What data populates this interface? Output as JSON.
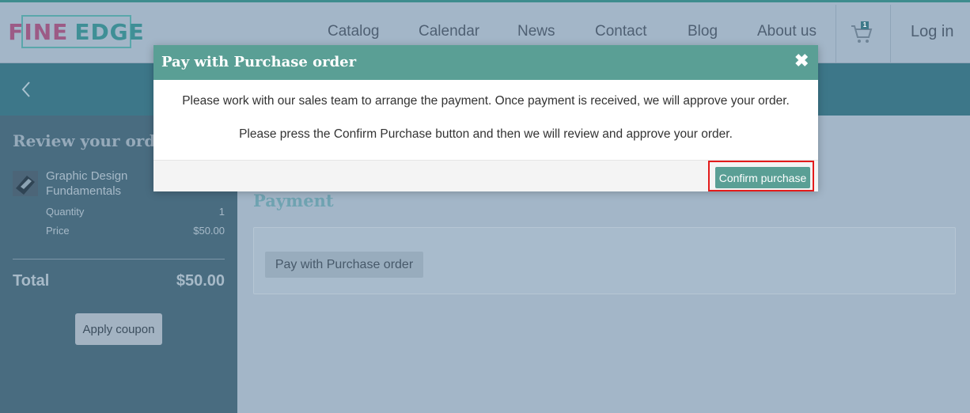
{
  "header": {
    "logo_word1": "FINE",
    "logo_word2": "EDGE",
    "nav": [
      "Catalog",
      "Calendar",
      "News",
      "Contact",
      "Blog",
      "About us"
    ],
    "cart_count": "1",
    "login": "Log in"
  },
  "sidebar": {
    "title": "Review your order",
    "item": {
      "name": "Graphic Design Fundamentals",
      "quantity_label": "Quantity",
      "quantity": "1",
      "price_label": "Price",
      "price": "$50.00"
    },
    "total_label": "Total",
    "total": "$50.00",
    "coupon_button": "Apply coupon"
  },
  "main": {
    "payment_title": "Payment",
    "pay_po_button": "Pay with Purchase order"
  },
  "modal": {
    "title": "Pay with Purchase order",
    "close_icon": "close-icon",
    "message1": "Please work with our sales team to arrange the payment. Once payment is received, we will approve your order.",
    "message2": "Please press the Confirm Purchase button and then we will review and approve your order.",
    "confirm_button": "Confirm purchase"
  },
  "colors": {
    "accent": "#5a9f95",
    "band": "#3d7789",
    "sidebar": "#496c80",
    "highlight": "#e31b1b"
  }
}
